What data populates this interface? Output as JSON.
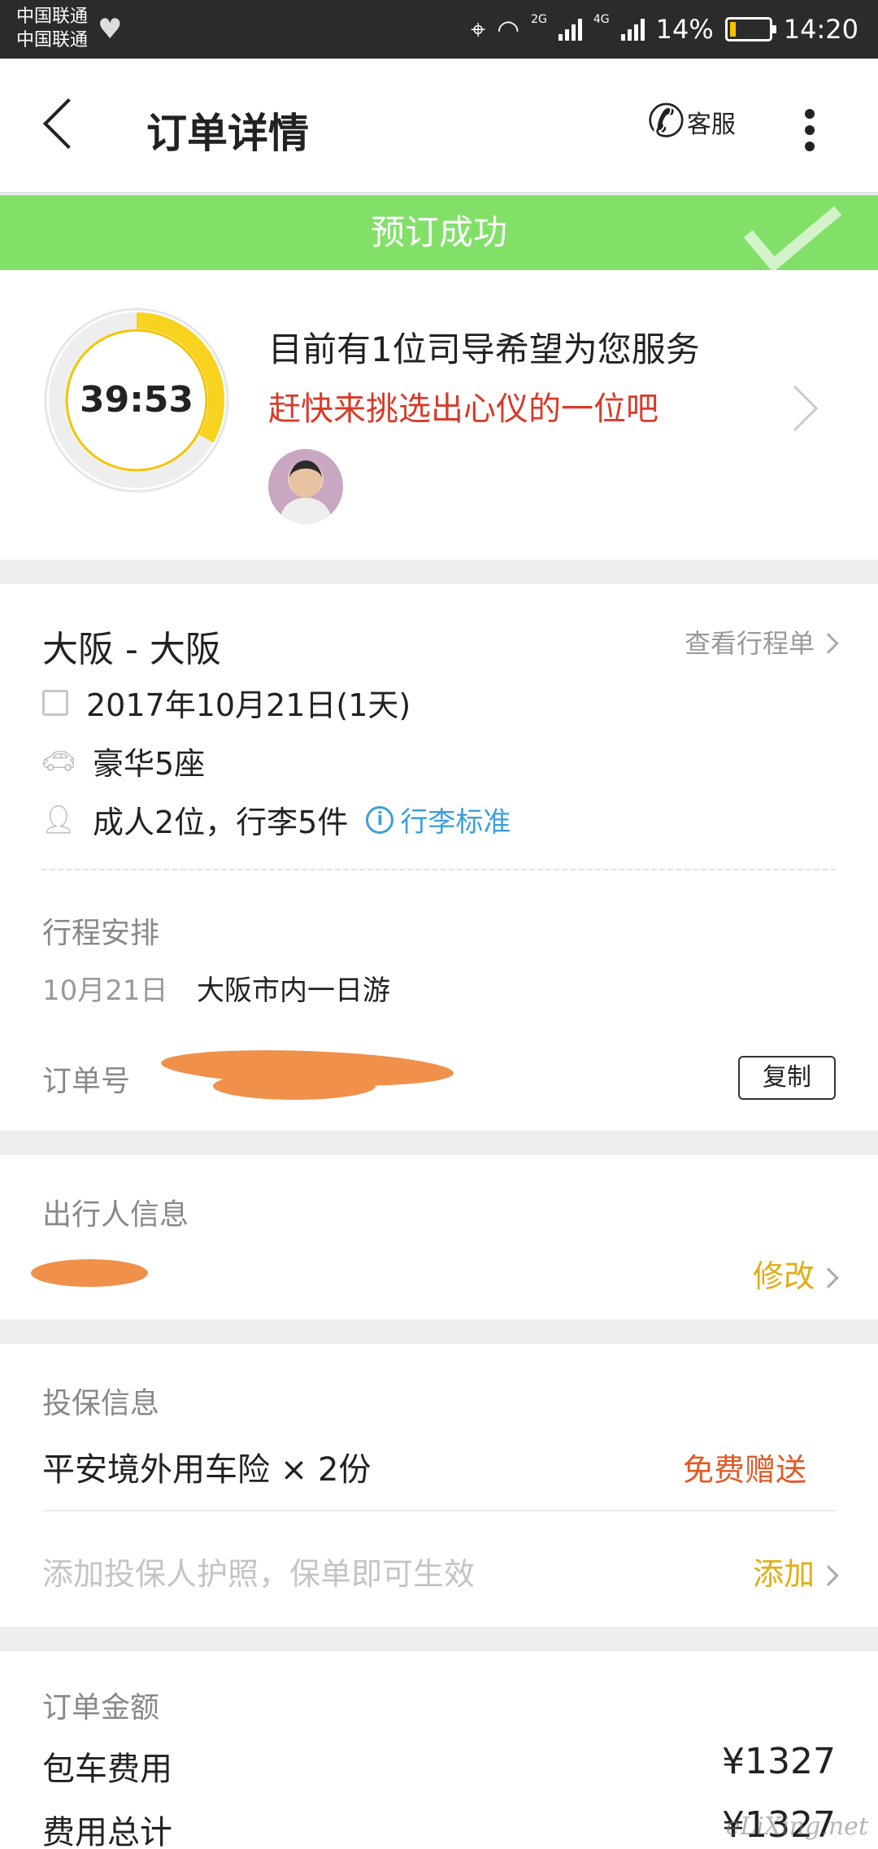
{
  "status_bar": {
    "carrier1": "中国联通",
    "carrier2": "中国联通",
    "net1": "2G",
    "net2": "4G",
    "battery": "14%",
    "battery_level": 0.14,
    "time": "14:20"
  },
  "nav": {
    "title": "订单详情",
    "service_label": "客服"
  },
  "banner": {
    "text": "预订成功",
    "color": "#82e069"
  },
  "countdown": {
    "time": "39:53",
    "progress_remaining": 0.33,
    "message": "目前有1位司导希望为您服务",
    "prompt": "赶快来挑选出心仪的一位吧"
  },
  "trip": {
    "route": "大阪 - 大阪",
    "itinerary_link": "查看行程单",
    "date": "2017年10月21日(1天)",
    "car": "豪华5座",
    "passengers": "成人2位，行李5件",
    "luggage_link": "行李标准",
    "schedule_label": "行程安排",
    "schedule_date": "10月21日",
    "schedule_desc": "大阪市内一日游",
    "order_no_label": "订单号",
    "copy_label": "复制"
  },
  "traveler": {
    "label": "出行人信息",
    "edit_label": "修改"
  },
  "insurance": {
    "label": "投保信息",
    "item": "平安境外用车险 × 2份",
    "free_label": "免费赠送",
    "hint": "添加投保人护照，保单即可生效",
    "add_label": "添加"
  },
  "amount": {
    "label": "订单金额",
    "charter_label": "包车费用",
    "charter_value": "¥1327",
    "total_label": "费用总计",
    "total_value": "¥1327"
  },
  "watermark": "eLiXing.net",
  "colors": {
    "accent_yellow": "#f7d21f",
    "link_blue": "#3ba0d8",
    "alert_red": "#d83b2a",
    "gold": "#e0ad16"
  }
}
